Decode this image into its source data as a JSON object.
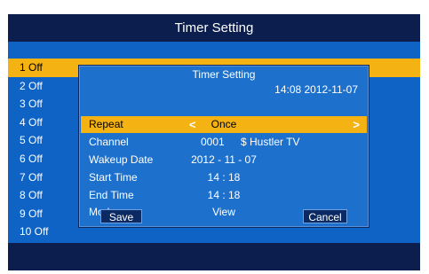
{
  "window": {
    "title": "Timer Setting"
  },
  "timers": [
    {
      "label": "1 Off"
    },
    {
      "label": "2 Off"
    },
    {
      "label": "3 Off"
    },
    {
      "label": "4 Off"
    },
    {
      "label": "5 Off"
    },
    {
      "label": "6 Off"
    },
    {
      "label": "7 Off"
    },
    {
      "label": "8 Off"
    },
    {
      "label": "9 Off"
    },
    {
      "label": "10 Off"
    }
  ],
  "dialog": {
    "title": "Timer Setting",
    "datetime": "14:08 2012-11-07",
    "repeat": {
      "label": "Repeat",
      "value": "Once",
      "left_arrow": "<",
      "right_arrow": ">"
    },
    "channel": {
      "label": "Channel",
      "number": "0001",
      "name": "$ Hustler TV"
    },
    "wakeup_date": {
      "label": "Wakeup Date",
      "value": "2012 - 11 - 07"
    },
    "start_time": {
      "label": "Start Time",
      "value": "14 : 18"
    },
    "end_time": {
      "label": "End Time",
      "value": "14 : 18"
    },
    "mode": {
      "label": "Mode",
      "value": "View"
    },
    "save_label": "Save",
    "cancel_label": "Cancel"
  },
  "colors": {
    "background": "#0f63c4",
    "bar": "#0b1e4d",
    "highlight": "#f5b213",
    "dialog": "#1d71cc"
  }
}
